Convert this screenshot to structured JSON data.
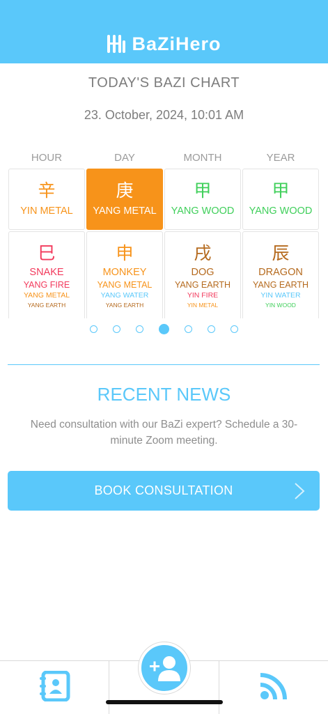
{
  "header": {
    "app_name": "BaZiHero"
  },
  "chart": {
    "title": "TODAY'S BAZI CHART",
    "datetime": "23. October, 2024, 10:01 AM",
    "columns": [
      "HOUR",
      "DAY",
      "MONTH",
      "YEAR"
    ],
    "stems": [
      {
        "char": "辛",
        "label": "YIN METAL"
      },
      {
        "char": "庚",
        "label": "YANG METAL"
      },
      {
        "char": "甲",
        "label": "YANG WOOD"
      },
      {
        "char": "甲",
        "label": "YANG WOOD"
      }
    ],
    "branches": [
      {
        "char": "巳",
        "animal": "SNAKE",
        "element": "YANG FIRE",
        "hidden1": "YANG METAL",
        "hidden2": "YANG EARTH"
      },
      {
        "char": "申",
        "animal": "MONKEY",
        "element": "YANG METAL",
        "hidden1": "YANG WATER",
        "hidden2": "YANG EARTH"
      },
      {
        "char": "戌",
        "animal": "DOG",
        "element": "YANG EARTH",
        "hidden1": "YIN FIRE",
        "hidden2": "YIN METAL"
      },
      {
        "char": "辰",
        "animal": "DRAGON",
        "element": "YANG EARTH",
        "hidden1": "YIN WATER",
        "hidden2": "YIN WOOD"
      }
    ],
    "selected_column": 1
  },
  "pager": {
    "count": 7,
    "active_index": 3
  },
  "news": {
    "title": "RECENT NEWS",
    "text": "Need consultation with our BaZi expert? Schedule a 30-minute Zoom meeting.",
    "button_label": "BOOK CONSULTATION"
  },
  "tabbar": {
    "tabs": [
      "contacts-icon",
      "add-user-icon",
      "feed-icon"
    ]
  },
  "colors": {
    "accent": "#5ac8fa",
    "metal_orange": "#f7931a",
    "wood_green": "#3fcf5a",
    "fire_red": "#f23a5c",
    "earth_brown": "#b56a1e"
  }
}
